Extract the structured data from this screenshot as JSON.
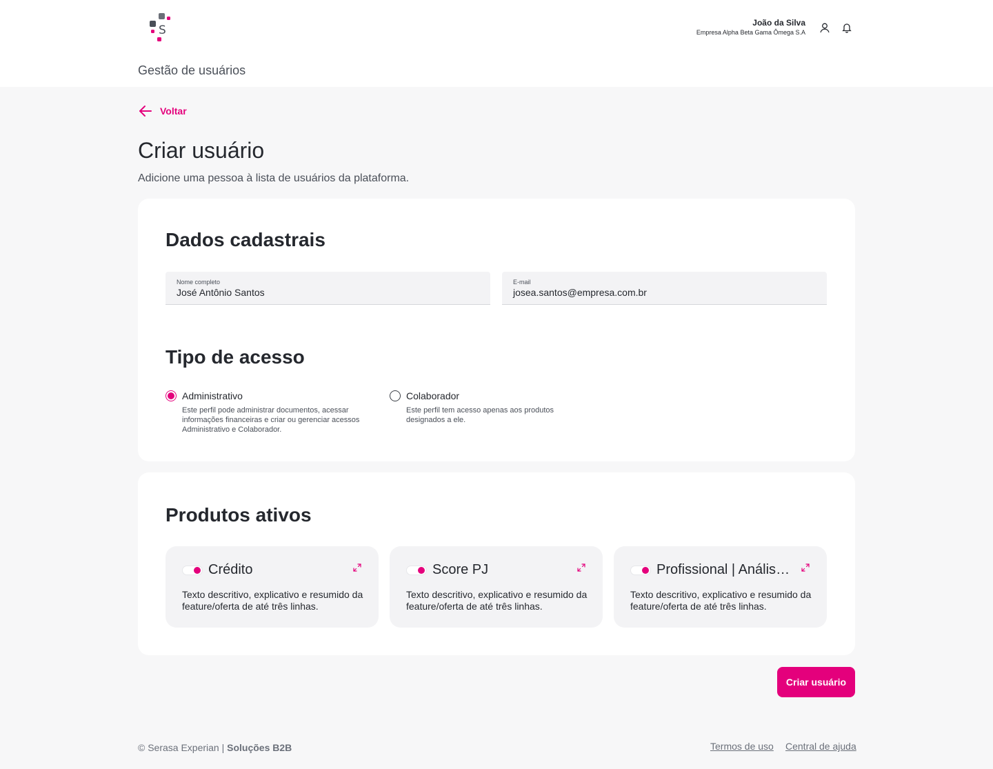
{
  "header": {
    "page_title": "Gestão de usuários",
    "user_name": "João da Silva",
    "user_company": "Empresa Alpha Beta Gama Ômega S.A"
  },
  "nav": {
    "back_label": "Voltar"
  },
  "main": {
    "title": "Criar usuário",
    "subtitle": "Adicione uma pessoa à lista de usuários da plataforma."
  },
  "form": {
    "section_title": "Dados cadastrais",
    "name": {
      "label": "Nome completo",
      "value": "José Antônio Santos"
    },
    "email": {
      "label": "E-mail",
      "value": "josea.santos@empresa.com.br"
    }
  },
  "access": {
    "section_title": "Tipo de acesso",
    "options": [
      {
        "label": "Administrativo",
        "description": "Este perfil pode administrar documentos, acessar informações financeiras e criar ou gerenciar acessos Administrativo e Colaborador.",
        "selected": true
      },
      {
        "label": "Colaborador",
        "description": "Este perfil tem acesso apenas aos produtos designados a ele.",
        "selected": false
      }
    ]
  },
  "products": {
    "section_title": "Produtos ativos",
    "items": [
      {
        "title": "Crédito",
        "description": "Texto descritivo, explicativo e resumido da feature/oferta de até três linhas.",
        "active": true
      },
      {
        "title": "Score PJ",
        "description": "Texto descritivo, explicativo e resumido da feature/oferta de até três linhas.",
        "active": true
      },
      {
        "title": "Profissional | Análise…",
        "description": "Texto descritivo, explicativo e resumido da feature/oferta de até três linhas.",
        "active": true
      }
    ]
  },
  "actions": {
    "submit_label": "Criar usuário"
  },
  "footer": {
    "copyright": "© Serasa Experian | ",
    "brand": "Soluções B2B",
    "links": [
      "Termos de uso",
      "Central de ajuda"
    ]
  },
  "colors": {
    "accent": "#e4007c",
    "text": "#25282e",
    "background": "#f7f7f8"
  },
  "icons": [
    "serasa-logo",
    "user-icon",
    "bell-icon",
    "arrow-left-icon",
    "expand-icon"
  ]
}
